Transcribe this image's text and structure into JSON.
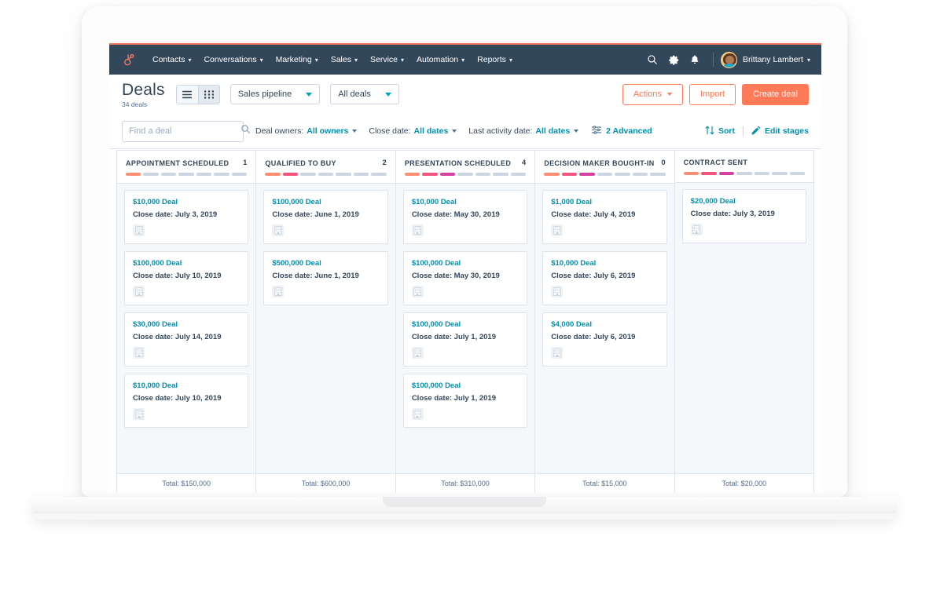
{
  "nav": {
    "logo_icon": "hubspot-sprocket-icon",
    "items": [
      {
        "label": "Contacts",
        "icon": "chevron-down-icon"
      },
      {
        "label": "Conversations",
        "icon": "chevron-down-icon"
      },
      {
        "label": "Marketing",
        "icon": "chevron-down-icon"
      },
      {
        "label": "Sales",
        "icon": "chevron-down-icon"
      },
      {
        "label": "Service",
        "icon": "chevron-down-icon"
      },
      {
        "label": "Automation",
        "icon": "chevron-down-icon"
      },
      {
        "label": "Reports",
        "icon": "chevron-down-icon"
      }
    ],
    "search_icon": "search-icon",
    "settings_icon": "gear-icon",
    "notifications_icon": "bell-icon",
    "avatar_icon": "avatar",
    "user_name": "Brittany Lambert",
    "user_caret": "chevron-down-icon",
    "background": "#33475b",
    "accent_top": "#f2785c"
  },
  "header": {
    "title": "Deals",
    "subtitle": "34 deals",
    "view_list_icon": "list-view-icon",
    "view_board_icon": "board-view-icon",
    "pipeline_select": "Sales pipeline",
    "deals_select": "All deals",
    "actions_label": "Actions",
    "import_label": "Import",
    "create_label": "Create deal",
    "accent": "#ff7a59"
  },
  "filters": {
    "search_placeholder": "Find a deal",
    "search_value": "",
    "search_icon": "search-icon",
    "deal_owners_label": "Deal owners:",
    "deal_owners_value": "All owners",
    "close_date_label": "Close date:",
    "close_date_value": "All dates",
    "last_activity_label": "Last activity date:",
    "last_activity_value": "All dates",
    "advanced_label": "2 Advanced",
    "advanced_icon": "filter-icon",
    "sort_label": "Sort",
    "sort_icon": "sort-icon",
    "edit_stages_label": "Edit stages",
    "edit_stages_icon": "pencil-icon",
    "link_color": "#0091ae"
  },
  "board": {
    "stage_colors": [
      "#ff8f73",
      "#f2547d",
      "#d6409f",
      "#cbd6e2",
      "#cbd6e2",
      "#cbd6e2",
      "#cbd6e2"
    ],
    "inactive_color": "#cbd6e2",
    "total_prefix": "Total: ",
    "card_icon": "company-building-icon",
    "date_prefix": "Close date: ",
    "columns": [
      {
        "name": "Appointment scheduled",
        "count": "1",
        "filled_segments": 1,
        "total": "Total: $150,000",
        "cards": [
          {
            "title": "$10,000 Deal",
            "date": "Close date: July 3, 2019"
          },
          {
            "title": "$100,000 Deal",
            "date": "Close date: July 10, 2019"
          },
          {
            "title": "$30,000 Deal",
            "date": "Close date: July 14, 2019"
          },
          {
            "title": "$10,000 Deal",
            "date": "Close date: July 10, 2019"
          }
        ]
      },
      {
        "name": "Qualified to buy",
        "count": "2",
        "filled_segments": 2,
        "total": "Total: $600,000",
        "cards": [
          {
            "title": "$100,000 Deal",
            "date": "Close date: June 1, 2019"
          },
          {
            "title": "$500,000 Deal",
            "date": "Close date: June 1, 2019"
          }
        ]
      },
      {
        "name": "Presentation scheduled",
        "count": "4",
        "filled_segments": 3,
        "total": "Total: $310,000",
        "cards": [
          {
            "title": "$10,000 Deal",
            "date": "Close date: May 30, 2019"
          },
          {
            "title": "$100,000 Deal",
            "date": "Close date: May 30, 2019"
          },
          {
            "title": "$100,000 Deal",
            "date": "Close date: July 1, 2019"
          },
          {
            "title": "$100,000 Deal",
            "date": "Close date: July 1, 2019"
          }
        ]
      },
      {
        "name": "Decision maker bought-in",
        "count": "0",
        "filled_segments": 3,
        "total": "Total: $15,000",
        "cards": [
          {
            "title": "$1,000 Deal",
            "date": "Close date: July 4, 2019"
          },
          {
            "title": "$10,000 Deal",
            "date": "Close date: July 6, 2019"
          },
          {
            "title": "$4,000 Deal",
            "date": "Close date: July 6, 2019"
          }
        ]
      },
      {
        "name": "Contract sent",
        "count": "",
        "filled_segments": 3,
        "total": "Total: $20,000",
        "cards": [
          {
            "title": "$20,000 Deal",
            "date": "Close date: July 3, 2019"
          }
        ]
      }
    ]
  }
}
